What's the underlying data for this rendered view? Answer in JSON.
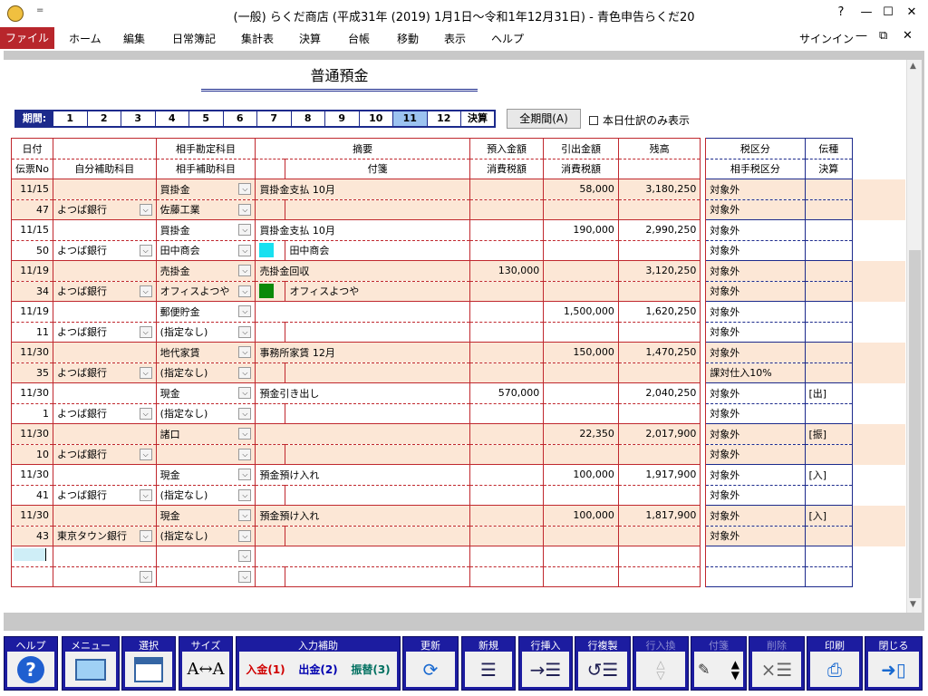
{
  "window": {
    "title": "(一般) らくだ商店 (平成31年 (2019) 1月1日～令和1年12月31日) - 青色申告らくだ20",
    "help_btn": "?",
    "min_btn": "—",
    "max_btn": "☐",
    "close_btn": "✕"
  },
  "quick_access": "=",
  "menu": {
    "items": [
      "ファイル",
      "ホーム",
      "編集",
      "日常簿記",
      "集計表",
      "決算",
      "台帳",
      "移動",
      "表示",
      "ヘルプ"
    ],
    "signin": "サインイン",
    "min_btn": "—",
    "restore_btn": "⧉",
    "close_btn": "✕"
  },
  "document": {
    "title": "普通預金"
  },
  "period": {
    "label": "期間:",
    "months": [
      "1",
      "2",
      "3",
      "4",
      "5",
      "6",
      "7",
      "8",
      "9",
      "10",
      "11",
      "12"
    ],
    "selected": "11",
    "kessan": "決算",
    "all_period_btn": "全期間(A)",
    "today_only": "本日仕訳のみ表示",
    "today_only_checked": false
  },
  "headers": {
    "row1": [
      "日付",
      "",
      "相手勘定科目",
      "摘要",
      "",
      "預入金額",
      "引出金額",
      "残高",
      "税区分",
      "伝種"
    ],
    "row2": [
      "伝票No",
      "自分補助科目",
      "相手補助科目",
      "",
      "付箋",
      "消費税額",
      "消費税額",
      "",
      "相手税区分",
      "決算"
    ]
  },
  "entries": [
    {
      "date": "11/15",
      "no": "47",
      "self_sub": "よつば銀行",
      "acct": "買掛金",
      "acct_sub": "佐藤工業",
      "desc": "買掛金支払 10月",
      "note": "",
      "note_color": "",
      "deposit": "",
      "withdraw": "58,000",
      "balance": "3,180,250",
      "tax": "対象外",
      "tax2": "対象外",
      "kind": "",
      "shade": true
    },
    {
      "date": "11/15",
      "no": "50",
      "self_sub": "よつば銀行",
      "acct": "買掛金",
      "acct_sub": "田中商会",
      "desc": "買掛金支払 10月",
      "note": "田中商会",
      "note_color": "#18e0f0",
      "deposit": "",
      "withdraw": "190,000",
      "balance": "2,990,250",
      "tax": "対象外",
      "tax2": "対象外",
      "kind": "",
      "shade": false
    },
    {
      "date": "11/19",
      "no": "34",
      "self_sub": "よつば銀行",
      "acct": "売掛金",
      "acct_sub": "オフィスよつや",
      "desc": "売掛金回収",
      "note": "オフィスよつや",
      "note_color": "#0a8a0a",
      "deposit": "130,000",
      "withdraw": "",
      "balance": "3,120,250",
      "tax": "対象外",
      "tax2": "対象外",
      "kind": "",
      "shade": true
    },
    {
      "date": "11/19",
      "no": "11",
      "self_sub": "よつば銀行",
      "acct": "郵便貯金",
      "acct_sub": "(指定なし)",
      "desc": "",
      "note": "",
      "note_color": "",
      "deposit": "",
      "withdraw": "1,500,000",
      "balance": "1,620,250",
      "tax": "対象外",
      "tax2": "対象外",
      "kind": "",
      "shade": false
    },
    {
      "date": "11/30",
      "no": "35",
      "self_sub": "よつば銀行",
      "acct": "地代家賃",
      "acct_sub": "(指定なし)",
      "desc": "事務所家賃 12月",
      "note": "",
      "note_color": "",
      "deposit": "",
      "withdraw": "150,000",
      "balance": "1,470,250",
      "tax": "対象外",
      "tax2": "課対仕入10%",
      "kind": "",
      "shade": true
    },
    {
      "date": "11/30",
      "no": "1",
      "self_sub": "よつば銀行",
      "acct": "現金",
      "acct_sub": "(指定なし)",
      "desc": "預金引き出し",
      "note": "",
      "note_color": "",
      "deposit": "570,000",
      "withdraw": "",
      "balance": "2,040,250",
      "tax": "対象外",
      "tax2": "対象外",
      "kind": "[出]",
      "shade": false
    },
    {
      "date": "11/30",
      "no": "10",
      "self_sub": "よつば銀行",
      "acct": "諸口",
      "acct_sub": "",
      "desc": "",
      "note": "",
      "note_color": "",
      "deposit": "",
      "withdraw": "22,350",
      "balance": "2,017,900",
      "tax": "対象外",
      "tax2": "対象外",
      "kind": "[振]",
      "shade": true
    },
    {
      "date": "11/30",
      "no": "41",
      "self_sub": "よつば銀行",
      "acct": "現金",
      "acct_sub": "(指定なし)",
      "desc": "預金預け入れ",
      "note": "",
      "note_color": "",
      "deposit": "",
      "withdraw": "100,000",
      "balance": "1,917,900",
      "tax": "対象外",
      "tax2": "対象外",
      "kind": "[入]",
      "shade": false
    },
    {
      "date": "11/30",
      "no": "43",
      "self_sub": "東京タウン銀行",
      "acct": "現金",
      "acct_sub": "(指定なし)",
      "desc": "預金預け入れ",
      "note": "",
      "note_color": "",
      "deposit": "",
      "withdraw": "100,000",
      "balance": "1,817,900",
      "tax": "対象外",
      "tax2": "対象外",
      "kind": "[入]",
      "shade": true
    }
  ],
  "dropdown_glyph": "⌵",
  "toolbar": {
    "help": "ヘルプ",
    "help_glyph": "?",
    "menu": "メニュー",
    "select": "選択",
    "size": "サイズ",
    "size_glyph": "A↔A",
    "input_assist": "入力補助",
    "deposit": "入金(1)",
    "withdraw": "出金(2)",
    "transfer": "振替(3)",
    "update": "更新",
    "update_glyph": "⟳",
    "new": "新規",
    "new_glyph": "☰",
    "insert_row": "行挿入",
    "insert_glyph": "→☰",
    "copy_row": "行複製",
    "copy_glyph": "↺☰",
    "swap_row": "行入換",
    "swap_up": "△",
    "swap_down": "▽",
    "note": "付箋",
    "note_glyph": "✎",
    "note_up": "▲",
    "note_down": "▼",
    "delete": "削除",
    "delete_glyph": "×☰",
    "print": "印刷",
    "print_glyph": "⎙",
    "close": "閉じる",
    "close_glyph": "➜▯"
  }
}
